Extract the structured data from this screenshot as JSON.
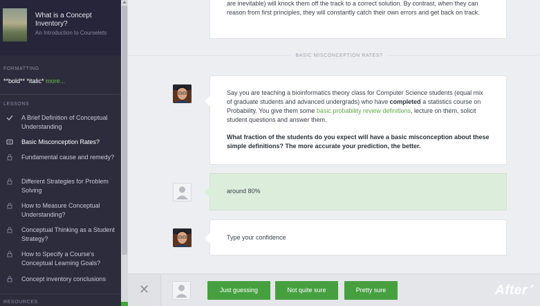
{
  "sidebar": {
    "course_title": "What is a Concept Inventory?",
    "course_subtitle": "An Introduction to Courselets",
    "formatting_label": "FORMATTING",
    "formatting_bold": "**bold**",
    "formatting_italic": "*italic*",
    "formatting_more": "more...",
    "lessons_label": "LESSONS",
    "resources_label": "RESOURCES",
    "lessons": [
      {
        "label": "A Brief Definition of Conceptual Understanding",
        "icon": "check-icon"
      },
      {
        "label": "Basic Misconception Rates?",
        "icon": "chat-icon"
      },
      {
        "label": "Fundamental cause and remedy?",
        "icon": "lock-icon"
      },
      {
        "label": "Different Strategies for Problem Solving",
        "icon": "lock-icon"
      },
      {
        "label": "How to Measure Conceptual Understanding?",
        "icon": "lock-icon"
      },
      {
        "label": "Conceptual Thinking as a Student Strategy?",
        "icon": "lock-icon"
      },
      {
        "label": "How to Specify a Course's Conceptual Learning Goals?",
        "icon": "lock-icon"
      },
      {
        "label": "Concept inventory conclusions",
        "icon": "lock-icon"
      }
    ]
  },
  "chat": {
    "top_card_text": "are inevitable) will knock them off the track to a correct solution. By contrast, when they can reason from first principles, they will constantly catch their own errors and get back on track.",
    "section_title": "BASIC MISCONCEPTION RATES?",
    "question_p1_a": "Say you are teaching a bioinformatics theory class for Computer Science students (equal mix of graduate students and advanced undergrads) who have ",
    "question_p1_bold": "completed",
    "question_p1_b": " a statistics course on Probability. You give them some ",
    "question_p1_link": "basic probability review definitions",
    "question_p1_c": ", lecture on them, solicit student questions and answer them.",
    "question_p2": "What fraction of the students do you expect will have a basic misconception about these simple definitions? The more accurate your prediction, the better.",
    "answer_text": "around 80%",
    "confidence_prompt": "Type your confidence"
  },
  "bottom_bar": {
    "close_label": "✕",
    "buttons": [
      "Just guessing",
      "Not quite sure",
      "Pretty sure"
    ]
  },
  "watermark": "After",
  "colors": {
    "sidebar_bg": "#2d2c3d",
    "accent_green": "#46a040",
    "link_green": "#5ea946",
    "answer_bg": "#dceedb"
  }
}
